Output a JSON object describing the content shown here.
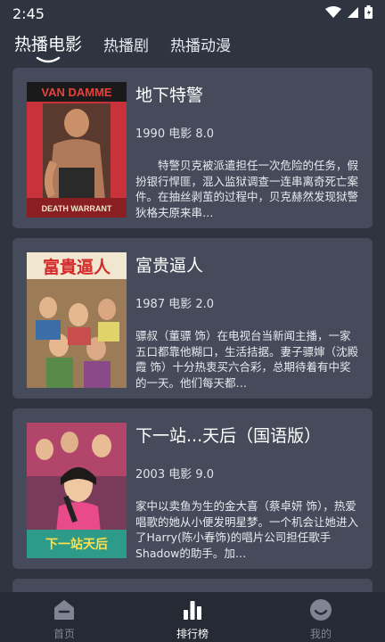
{
  "status": {
    "time": "2:45"
  },
  "tabs": [
    {
      "label": "热播电影",
      "active": true
    },
    {
      "label": "热播剧",
      "active": false
    },
    {
      "label": "热播动漫",
      "active": false
    }
  ],
  "movies": [
    {
      "title": "地下特警",
      "meta": "1990 电影 8.0",
      "description": "　　特警贝克被派遣担任一次危险的任务，假扮银行悍匪，混入监狱调查一连串离奇死亡案件。在抽丝剥茧的过程中，贝克赫然发现狱警狄格夫原来串…",
      "poster_text_top": "VAN DAMME",
      "poster_text_bottom": "DEATH WARRANT"
    },
    {
      "title": "富贵逼人",
      "meta": "1987 电影 2.0",
      "description": "骠叔（董骠 饰）在电视台当新闻主播，一家五口都靠他糊口，生活拮据。妻子骠婶（沈殿霞 饰）十分热衷买六合彩，总期待着有中奖的一天。他们每天都…",
      "poster_text_top": "富貴逼人",
      "poster_text_bottom": ""
    },
    {
      "title": "下一站...天后（国语版）",
      "meta": "2003 电影 9.0",
      "description": "家中以卖鱼为生的金大喜（蔡卓妍 饰），热爱唱歌的她从小便发明星梦。一个机会让她进入了Harry(陈小春饰)的唱片公司担任歌手Shadow的助手。加…",
      "poster_text_top": "",
      "poster_text_bottom": "下一站天后"
    }
  ],
  "nav": [
    {
      "label": "首页",
      "icon": "home-icon",
      "active": false
    },
    {
      "label": "排行榜",
      "icon": "ranking-icon",
      "active": true
    },
    {
      "label": "我的",
      "icon": "profile-icon",
      "active": false
    }
  ],
  "colors": {
    "background": "#2f3441",
    "card": "#454b5a",
    "nav_background": "#262a34",
    "nav_inactive": "#7f8593"
  }
}
